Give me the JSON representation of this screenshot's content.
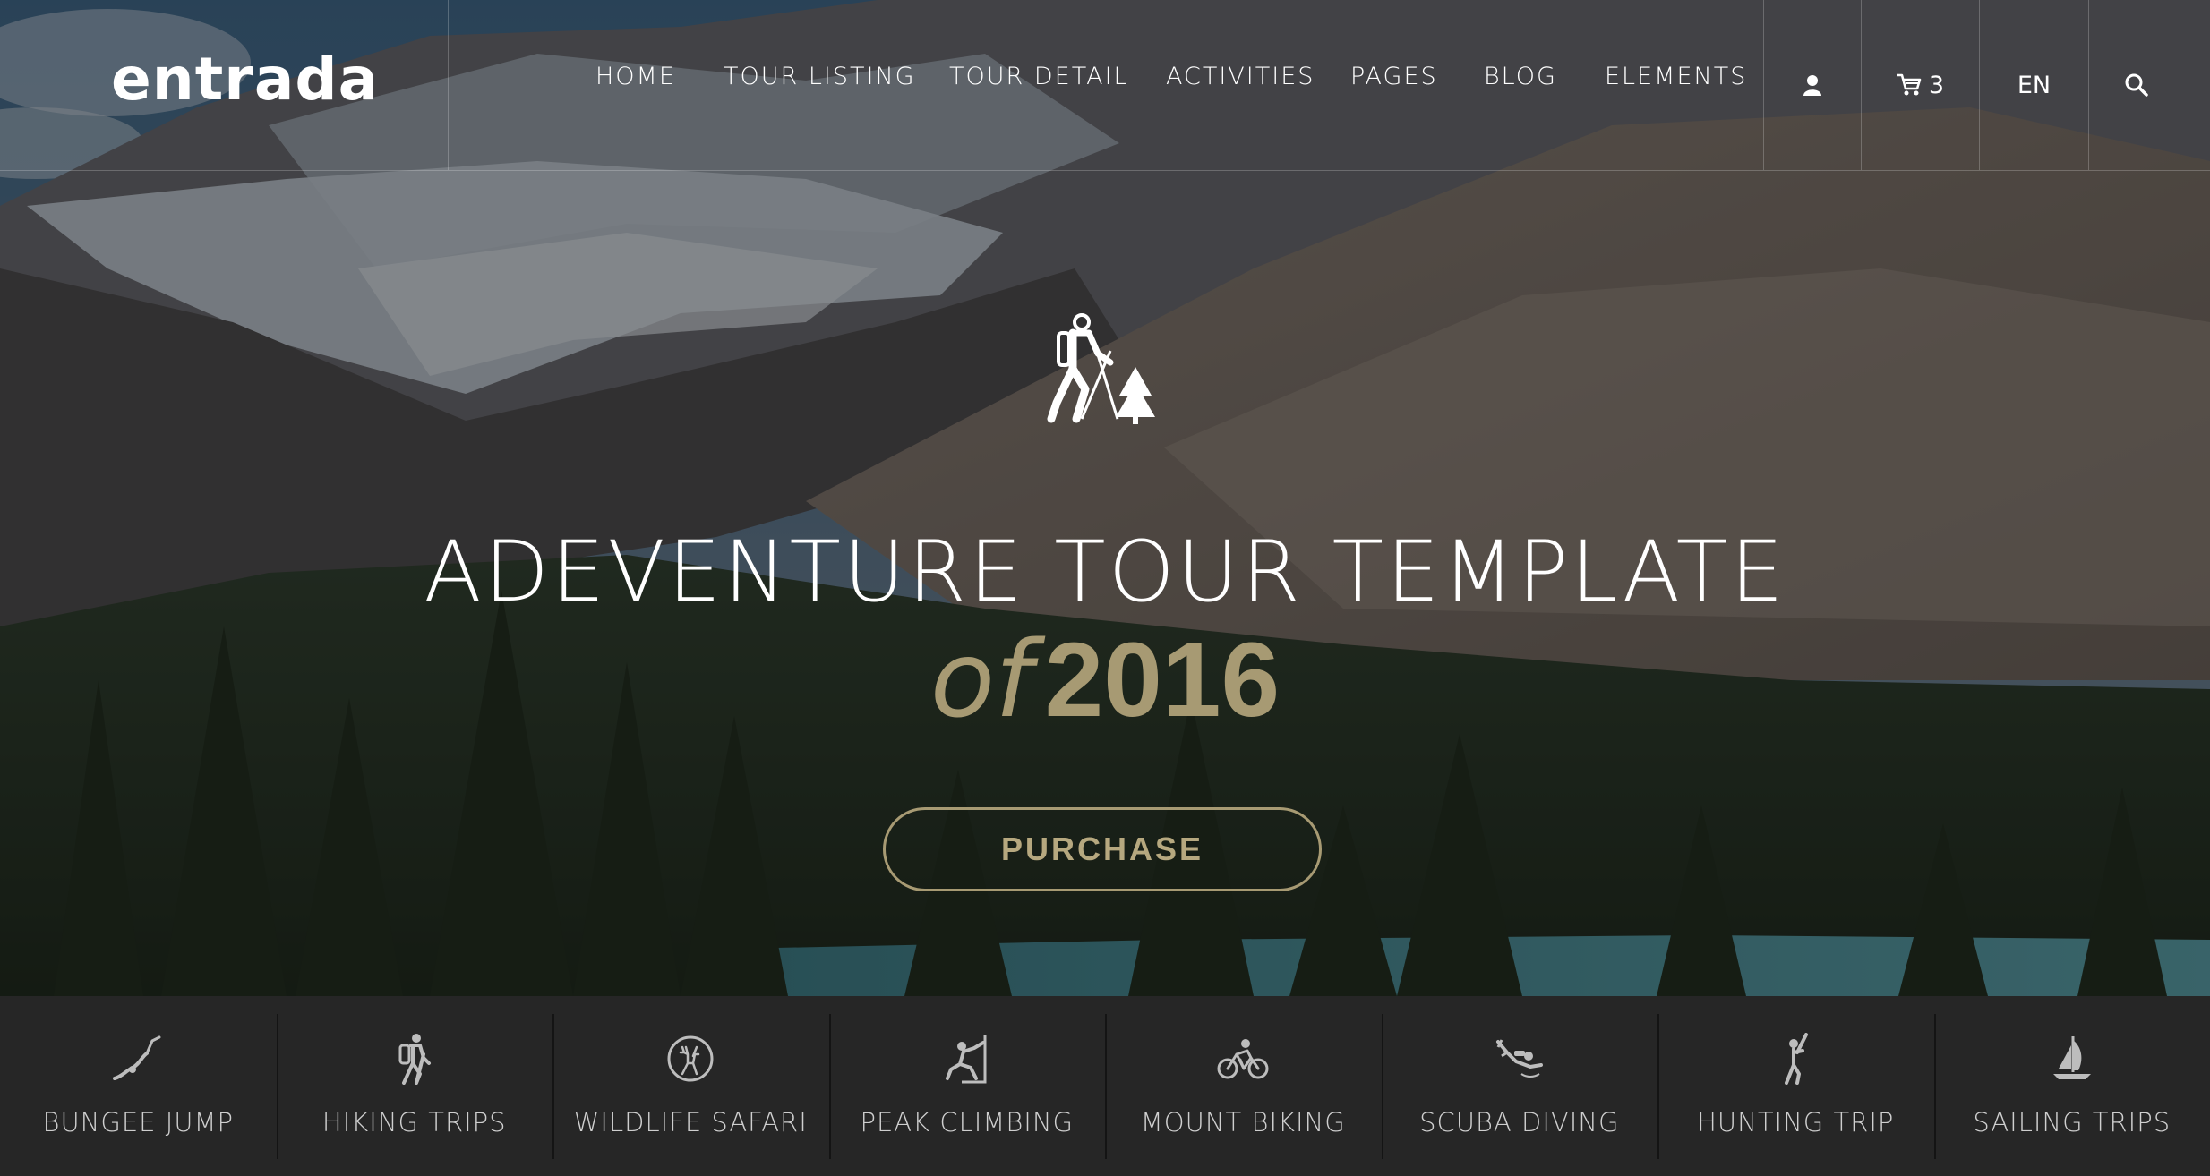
{
  "brand": {
    "logo": "entrada"
  },
  "nav": {
    "items": [
      {
        "label": "HOME"
      },
      {
        "label": "TOUR LISTING"
      },
      {
        "label": "TOUR DETAIL"
      },
      {
        "label": "ACTIVITIES"
      },
      {
        "label": "PAGES"
      },
      {
        "label": "BLOG"
      },
      {
        "label": "ELEMENTS"
      }
    ],
    "user_icon": "user-icon",
    "cart": {
      "icon": "cart-icon",
      "count": "3"
    },
    "language": "EN",
    "search_icon": "search-icon"
  },
  "hero": {
    "icon": "hiker-with-tree-icon",
    "title": "ADEVENTURE TOUR TEMPLATE",
    "subtitle_prefix": "of",
    "subtitle_year": "2016",
    "cta_label": "PURCHASE"
  },
  "activities": [
    {
      "label": "BUNGEE JUMP",
      "icon": "bungee-jump-icon"
    },
    {
      "label": "HIKING TRIPS",
      "icon": "hiking-icon"
    },
    {
      "label": "WILDLIFE SAFARI",
      "icon": "deer-icon"
    },
    {
      "label": "PEAK CLIMBING",
      "icon": "climbing-icon"
    },
    {
      "label": "MOUNT BIKING",
      "icon": "bicycle-icon"
    },
    {
      "label": "SCUBA DIVING",
      "icon": "diver-icon"
    },
    {
      "label": "HUNTING TRIP",
      "icon": "hunter-icon"
    },
    {
      "label": "SAILING TRIPS",
      "icon": "sailboat-icon"
    }
  ],
  "colors": {
    "accent": "#a79a73",
    "header_text": "#ffffff",
    "activity_bar_bg": "#262626",
    "activity_text": "#cfcfcf"
  }
}
